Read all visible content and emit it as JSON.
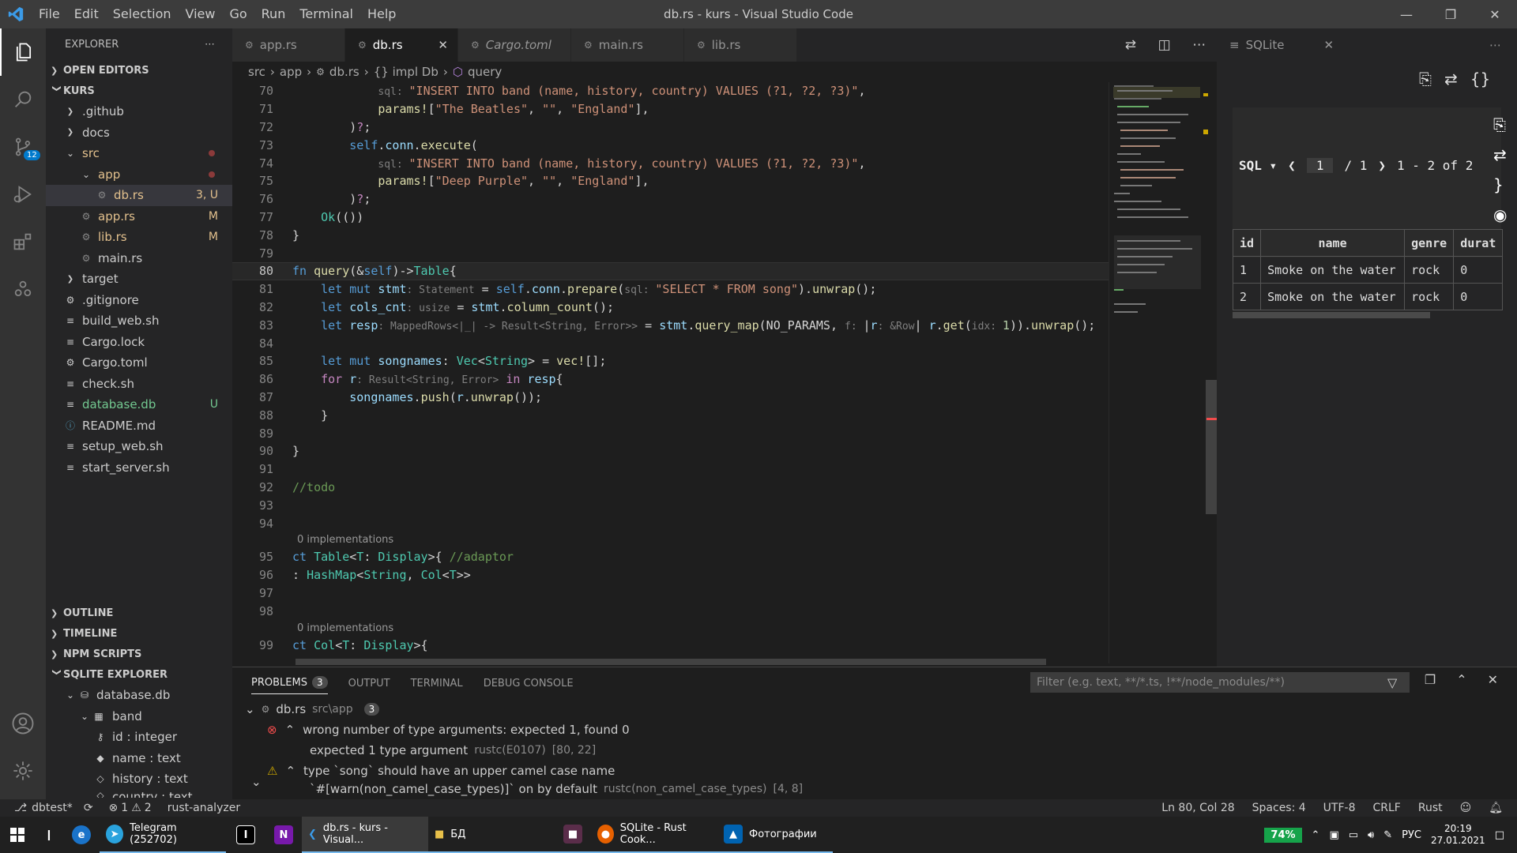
{
  "titlebar": {
    "menu": [
      "File",
      "Edit",
      "Selection",
      "View",
      "Go",
      "Run",
      "Terminal",
      "Help"
    ],
    "title": "db.rs - kurs - Visual Studio Code"
  },
  "activity": {
    "scm_badge": "12"
  },
  "explorer": {
    "title": "EXPLORER",
    "open_editors": "OPEN EDITORS",
    "root": "KURS",
    "items": [
      {
        "label": ".github",
        "depth": 1,
        "kind": "folder-closed",
        "status": ""
      },
      {
        "label": "docs",
        "depth": 1,
        "kind": "folder-closed",
        "status": ""
      },
      {
        "label": "src",
        "depth": 1,
        "kind": "folder-open",
        "status": "dot"
      },
      {
        "label": "app",
        "depth": 2,
        "kind": "folder-open",
        "status": "dot"
      },
      {
        "label": "db.rs",
        "depth": 3,
        "kind": "rust",
        "status": "3, U"
      },
      {
        "label": "app.rs",
        "depth": 2,
        "kind": "rust",
        "status": "M"
      },
      {
        "label": "lib.rs",
        "depth": 2,
        "kind": "rust",
        "status": "M"
      },
      {
        "label": "main.rs",
        "depth": 2,
        "kind": "rust",
        "status": ""
      },
      {
        "label": "target",
        "depth": 1,
        "kind": "folder-closed",
        "status": ""
      },
      {
        "label": ".gitignore",
        "depth": 1,
        "kind": "gear",
        "status": ""
      },
      {
        "label": "build_web.sh",
        "depth": 1,
        "kind": "file",
        "status": ""
      },
      {
        "label": "Cargo.lock",
        "depth": 1,
        "kind": "lines",
        "status": ""
      },
      {
        "label": "Cargo.toml",
        "depth": 1,
        "kind": "gear",
        "status": ""
      },
      {
        "label": "check.sh",
        "depth": 1,
        "kind": "file",
        "status": ""
      },
      {
        "label": "database.db",
        "depth": 1,
        "kind": "file",
        "status": "U"
      },
      {
        "label": "README.md",
        "depth": 1,
        "kind": "info",
        "status": ""
      },
      {
        "label": "setup_web.sh",
        "depth": 1,
        "kind": "file",
        "status": ""
      },
      {
        "label": "start_server.sh",
        "depth": 1,
        "kind": "file",
        "status": ""
      }
    ],
    "outline": "OUTLINE",
    "timeline": "TIMELINE",
    "npm": "NPM SCRIPTS",
    "sqlite_explorer": "SQLITE EXPLORER",
    "db": "database.db",
    "table": "band",
    "columns": [
      "id : integer",
      "name : text",
      "history : text",
      "country : text"
    ]
  },
  "tabs": [
    {
      "label": "app.rs",
      "active": false,
      "preview": false
    },
    {
      "label": "db.rs",
      "active": true,
      "preview": false
    },
    {
      "label": "Cargo.toml",
      "active": false,
      "preview": true
    },
    {
      "label": "main.rs",
      "active": false,
      "preview": false
    },
    {
      "label": "lib.rs",
      "active": false,
      "preview": false
    }
  ],
  "breadcrumb": [
    "src",
    "app",
    "db.rs",
    "{} impl Db",
    "query"
  ],
  "editor": {
    "lines": [
      {
        "n": "70",
        "html": "            <span class='h'>sql: </span><span class='s'>\"INSERT INTO band (name, history, country) VALUES (?1, ?2, ?3)\"</span>,"
      },
      {
        "n": "71",
        "html": "            <span class='f'>params!</span>[<span class='s'>\"The Beatles\"</span>, <span class='s'>\"\"</span>, <span class='s'>\"England\"</span>],"
      },
      {
        "n": "72",
        "html": "        )<span class='k2'>?</span>;"
      },
      {
        "n": "73",
        "html": "        <span class='k'>self</span>.<span class='v'>conn</span>.<span class='f'>execute</span>("
      },
      {
        "n": "74",
        "html": "            <span class='h'>sql: </span><span class='s'>\"INSERT INTO band (name, history, country) VALUES (?1, ?2, ?3)\"</span>,"
      },
      {
        "n": "75",
        "html": "            <span class='f'>params!</span>[<span class='s'>\"Deep Purple\"</span>, <span class='s'>\"\"</span>, <span class='s'>\"England\"</span>],"
      },
      {
        "n": "76",
        "html": "        )<span class='k2'>?</span>;"
      },
      {
        "n": "77",
        "html": "    <span class='t'>Ok</span>(())"
      },
      {
        "n": "78",
        "html": "}"
      },
      {
        "n": "79",
        "html": ""
      },
      {
        "n": "80",
        "html": "<span class='k'>fn</span> <span class='f'>query</span>(&amp;<span class='k'>self</span>)-&gt;<span class='t'>Table</span>{",
        "cur": true
      },
      {
        "n": "81",
        "html": "    <span class='k'>let mut</span> <span class='v'>stmt</span><span class='h'>: Statement</span> = <span class='k'>self</span>.<span class='v'>conn</span>.<span class='f'>prepare</span>(<span class='h'>sql: </span><span class='s'>\"SELECT * FROM song\"</span>).<span class='f'>unwrap</span>();"
      },
      {
        "n": "82",
        "html": "    <span class='k'>let</span> <span class='v'>cols_cnt</span><span class='h'>: usize</span> = <span class='v'>stmt</span>.<span class='f'>column_count</span>();"
      },
      {
        "n": "83",
        "html": "    <span class='k'>let</span> <span class='v'>resp</span><span class='h'>: MappedRows&lt;|_| -&gt; Result&lt;String, Error&gt;&gt;</span> = <span class='v'>stmt</span>.<span class='f'>query_map</span>(NO_PARAMS, <span class='h'>f: </span>|<span class='v'>r</span><span class='h'>: &amp;Row</span>| <span class='v'>r</span>.<span class='f'>get</span>(<span class='h'>idx: </span><span class='n'>1</span>)).<span class='f'>unwrap</span>();"
      },
      {
        "n": "84",
        "html": ""
      },
      {
        "n": "85",
        "html": "    <span class='k'>let mut</span> <span class='v'>songnames</span>: <span class='t'>Vec</span>&lt;<span class='t'>String</span>&gt; = <span class='f'>vec!</span>[];"
      },
      {
        "n": "86",
        "html": "    <span class='k2'>for</span> <span class='v'>r</span><span class='h'>: Result&lt;String, Error&gt;</span> <span class='k2'>in</span> <span class='v'>resp</span>{"
      },
      {
        "n": "87",
        "html": "        <span class='v'>songnames</span>.<span class='f'>push</span>(<span class='v'>r</span>.<span class='f'>unwrap</span>());"
      },
      {
        "n": "88",
        "html": "    }"
      },
      {
        "n": "89",
        "html": ""
      },
      {
        "n": "90",
        "html": "}"
      },
      {
        "n": "91",
        "html": ""
      },
      {
        "n": "92",
        "html": "<span class='c'>//todo</span>"
      },
      {
        "n": "93",
        "html": ""
      },
      {
        "n": "94",
        "html": ""
      },
      {
        "lens": "0 implementations"
      },
      {
        "n": "95",
        "html": "<span class='k'>ct</span> <span class='t'>Table</span>&lt;<span class='t'>T</span>: <span class='t'>Display</span>&gt;{ <span class='c'>//adaptor</span>"
      },
      {
        "n": "96",
        "html": "<span class='m'>: </span><span class='t'>HashMap</span>&lt;<span class='t'>String</span>, <span class='t'>Col</span>&lt;<span class='t'>T</span>&gt;&gt;"
      },
      {
        "n": "97",
        "html": ""
      },
      {
        "n": "98",
        "html": ""
      },
      {
        "lens": "0 implementations"
      },
      {
        "n": "99",
        "html": "<span class='k'>ct</span> <span class='t'>Col</span>&lt;<span class='t'>T</span>: <span class='t'>Display</span>&gt;{"
      }
    ]
  },
  "panel": {
    "tabs": [
      "PROBLEMS",
      "OUTPUT",
      "TERMINAL",
      "DEBUG CONSOLE"
    ],
    "problems_count": "3",
    "filter_placeholder": "Filter (e.g. text, **/*.ts, !**/node_modules/**)",
    "file": "db.rs",
    "file_path": "src\\app",
    "file_count": "3",
    "problems": [
      {
        "severity": "error",
        "msg": "wrong number of type arguments: expected 1, found 0",
        "detail": "expected 1 type argument",
        "src": "rustc(E0107)",
        "pos": "[80, 22]"
      },
      {
        "severity": "warning",
        "msg": "type `song` should have an upper camel case name",
        "detail": "`#[warn(non_camel_case_types)]` on by default",
        "src": "rustc(non_camel_case_types)",
        "pos": "[4, 8]"
      }
    ]
  },
  "sqlite": {
    "tab": "SQLite",
    "mode": "SQL",
    "page": "1",
    "pages": "/ 1",
    "range": "1 - 2 of 2",
    "columns": [
      "id",
      "name",
      "genre",
      "durat"
    ],
    "rows": [
      [
        "1",
        "Smoke on the water",
        "rock",
        "0"
      ],
      [
        "2",
        "Smoke on the water",
        "rock",
        "0"
      ]
    ]
  },
  "status": {
    "branch": "dbtest*",
    "errors": "1",
    "warnings": "2",
    "analyzer": "rust-analyzer",
    "position": "Ln 80, Col 28",
    "spaces": "Spaces: 4",
    "encoding": "UTF-8",
    "eol": "CRLF",
    "lang": "Rust"
  },
  "taskbar": {
    "telegram": "Telegram (252702)",
    "vscode": "db.rs - kurs - Visual...",
    "folder": "БД",
    "firefox": "SQLite - Rust Cook...",
    "photos": "Фотографии",
    "battery": "74%",
    "lang": "РУС",
    "time": "20:19",
    "date": "27.01.2021"
  },
  "colors": {
    "accent": "#007acc",
    "error": "#f14c4c",
    "warning": "#cca700"
  }
}
